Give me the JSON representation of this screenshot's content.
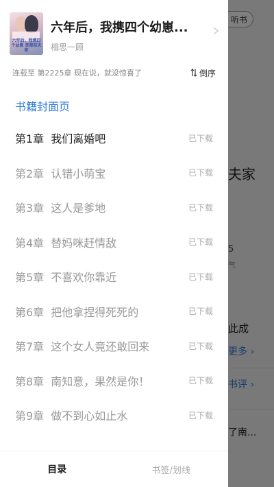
{
  "background": {
    "listen_label": "听书",
    "fragments": {
      "title": "夫家",
      "author": "5",
      "popularity": "气",
      "desc": "此成",
      "more": "更多 ›",
      "review": "书评 ›",
      "related": "了南..."
    }
  },
  "book": {
    "title": "六年后，我携四个幼崽...",
    "author": "相思一顾",
    "cover_text": "六年后，我携四个幼崽 首都前夫家"
  },
  "serial": {
    "status": "连载至 第2225章 现在说，就没惊喜了",
    "sort_label": "倒序"
  },
  "cover_page_link": "书籍封面页",
  "chapters": [
    {
      "num": "第1章",
      "title": "我们离婚吧",
      "status": "已下载",
      "current": true
    },
    {
      "num": "第2章",
      "title": "认错小萌宝",
      "status": "已下载",
      "current": false
    },
    {
      "num": "第3章",
      "title": "这人是爹地",
      "status": "已下载",
      "current": false
    },
    {
      "num": "第4章",
      "title": "替妈咪赶情敌",
      "status": "已下载",
      "current": false
    },
    {
      "num": "第5章",
      "title": "不喜欢你靠近",
      "status": "已下载",
      "current": false
    },
    {
      "num": "第6章",
      "title": "把他拿捏得死死的",
      "status": "已下载",
      "current": false
    },
    {
      "num": "第7章",
      "title": "这个女人竟还敢回来",
      "status": "已下载",
      "current": false
    },
    {
      "num": "第8章",
      "title": "南知意，果然是你！",
      "status": "已下载",
      "current": false
    },
    {
      "num": "第9章",
      "title": "做不到心如止水",
      "status": "已下载",
      "current": false
    }
  ],
  "tabs": {
    "catalog": "目录",
    "bookmarks": "书签/划线"
  },
  "colors": {
    "accent": "#2d7ad6",
    "current_chapter": "#222222",
    "chapter": "#999999"
  }
}
